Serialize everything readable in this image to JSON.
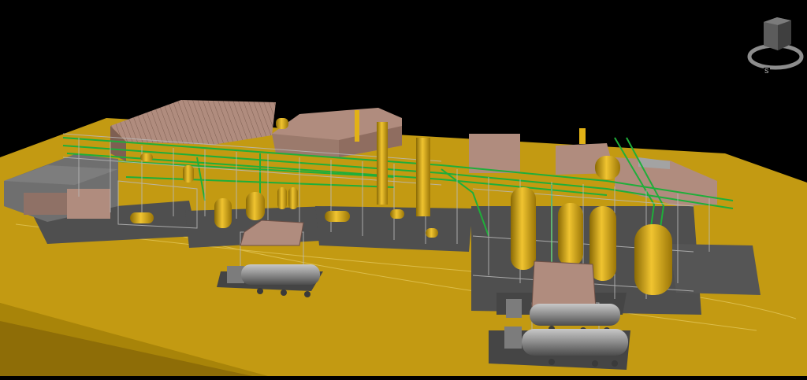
{
  "viewcube": {
    "compass_south_label": "S",
    "icon": "viewcube-icon"
  },
  "colors": {
    "background": "#000000",
    "ground": "#c39a12",
    "ground_edge": "#7d6208",
    "slab": "#4f4f4f",
    "roof": "#b08c7e",
    "pipe_green": "#1fae3a",
    "steel_gray": "#b9b9b9",
    "vessel_yellow": "#e2b216",
    "tanker": "#8a8a8a"
  }
}
